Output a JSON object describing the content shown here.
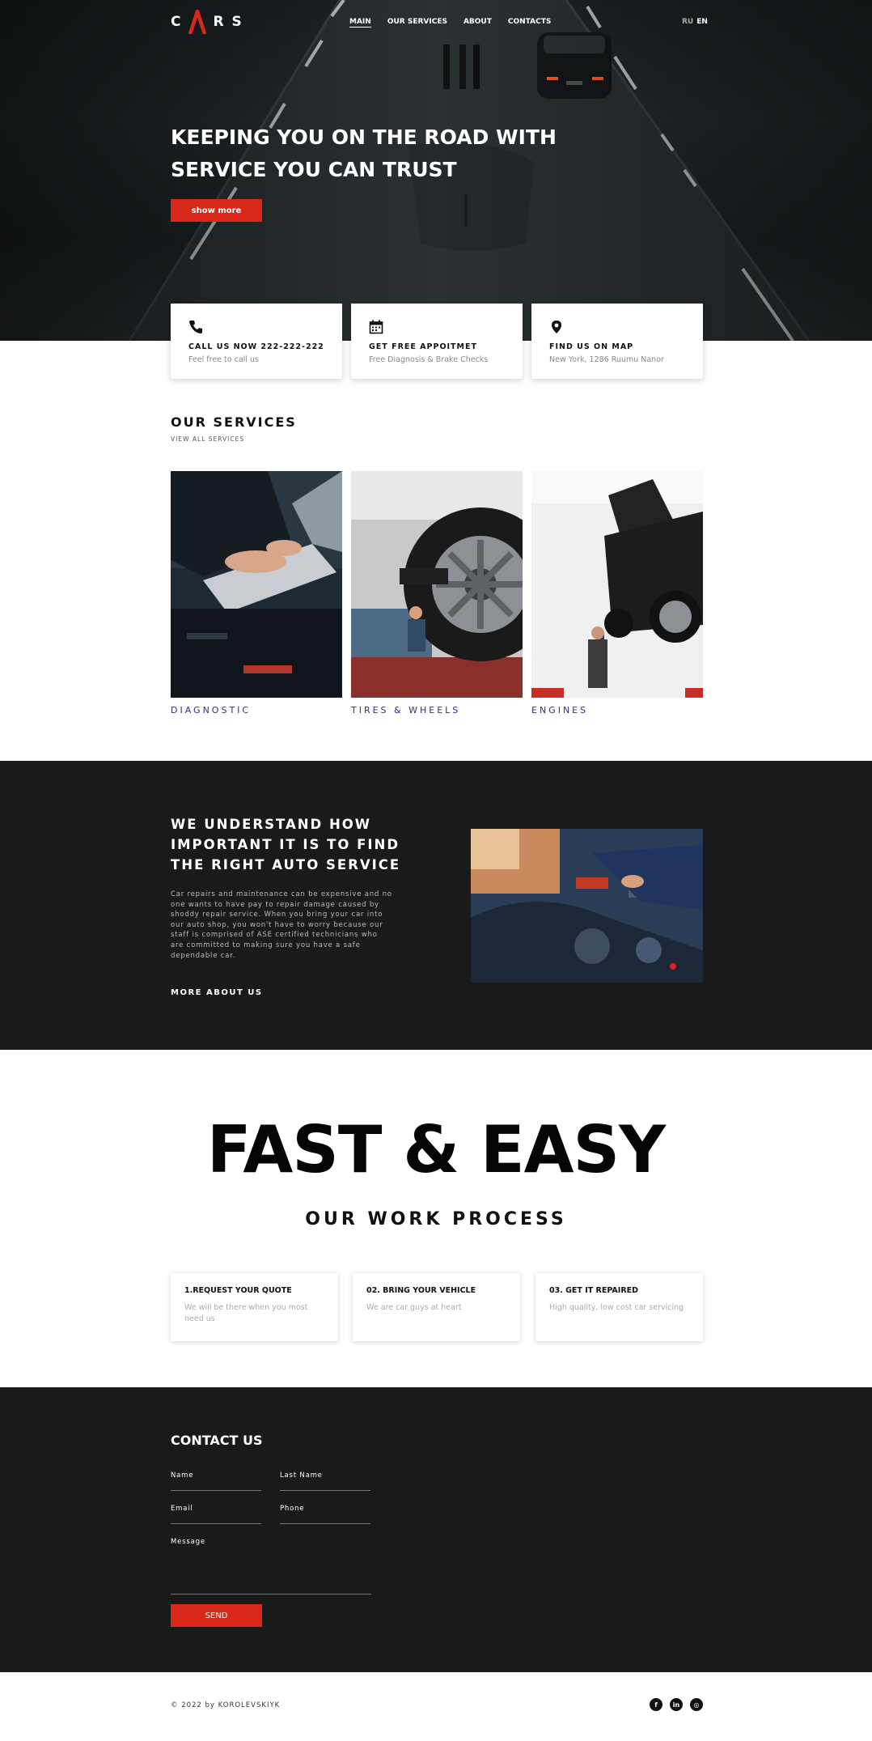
{
  "brand": {
    "logo_left": "C",
    "logo_right": "R S",
    "accent_color": "#d9281a",
    "dark_bg": "#1a1a1a",
    "purple_label": "#3c2a7a"
  },
  "nav": {
    "items": [
      "MAIN",
      "OUR SERVICES",
      "ABOUT",
      "CONTACTS"
    ],
    "active": "MAIN"
  },
  "lang": {
    "ru": "RU",
    "en": "EN",
    "selected": "EN"
  },
  "hero": {
    "title": "KEEPING YOU ON THE ROAD WITH SERVICE YOU CAN TRUST",
    "button": "show more"
  },
  "info_cards": [
    {
      "icon": "phone-icon",
      "title": "CALL US NOW 222-222-222",
      "subtitle": "Feel free to call us"
    },
    {
      "icon": "calendar-icon",
      "title": "GET FREE APPOITMET",
      "subtitle": "Free Diagnosis & Brake Checks"
    },
    {
      "icon": "map-pin-icon",
      "title": "FIND US ON MAP",
      "subtitle": "New York, 1286 Ruumu Nanor"
    }
  ],
  "services": {
    "title": "OUR SERVICES",
    "link": "VIEW ALL SERVICES",
    "items": [
      "DIAGNOSTIC",
      "TIRES & WHEELS",
      "ENGINES"
    ]
  },
  "about": {
    "title": "WE UNDERSTAND HOW IMPORTANT IT IS TO FIND THE RIGHT AUTO SERVICE",
    "text": "Car repairs and maintenance can be expensive and no one wants to have pay to repair damage caused by shoddy repair service. When you bring your car into our auto shop, you won't have to worry because our staff is comprised of ASE certified technicians who are committed to making sure you have a safe dependable car.",
    "link": "MORE ABOUT US"
  },
  "process": {
    "big_title": "FAST & EASY",
    "subtitle": "OUR WORK PROCESS",
    "steps": [
      {
        "title": "1.REQUEST YOUR QUOTE",
        "text": "We will be there when you most need us"
      },
      {
        "title": "02. BRING YOUR VEHICLE",
        "text": "We are car guys at heart"
      },
      {
        "title": "03. GET IT REPAIRED",
        "text": "High quality, low cost car servicing"
      }
    ]
  },
  "contact": {
    "title": "CONTACT US",
    "fields": {
      "name": "Name",
      "last_name": "Last Name",
      "email": "Email",
      "phone": "Phone",
      "message": "Message"
    },
    "button": "SEND"
  },
  "footer": {
    "copyright": "© 2022 by KOROLEVSKIYK",
    "social": [
      "facebook-icon",
      "linkedin-icon",
      "instagram-icon"
    ],
    "social_glyphs": [
      "f",
      "in",
      "◎"
    ]
  }
}
